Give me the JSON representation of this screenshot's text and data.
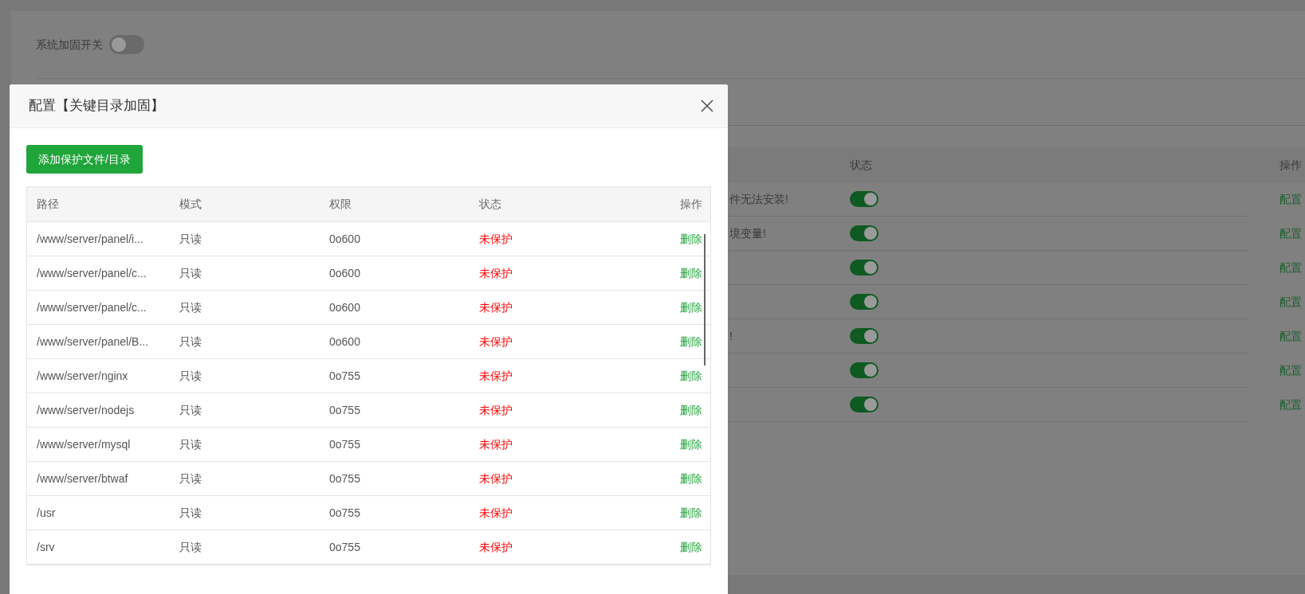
{
  "page": {
    "hardening_switch": {
      "label": "系统加固开关",
      "on": false
    },
    "table": {
      "columns": [
        "状态",
        "操作"
      ],
      "rows": [
        {
          "description": "件无法安装!",
          "on": true,
          "action": "配置"
        },
        {
          "description": "境变量!",
          "on": true,
          "action": "配置"
        },
        {
          "on": true,
          "action": "配置"
        },
        {
          "on": true,
          "action": "配置"
        },
        {
          "description": "!",
          "on": true,
          "action": "配置"
        },
        {
          "on": true,
          "action": "配置"
        },
        {
          "on": true,
          "action": "配置"
        }
      ]
    }
  },
  "dialog": {
    "title": "配置【关键目录加固】",
    "add_button": "添加保护文件/目录",
    "table": {
      "columns": [
        "路径",
        "模式",
        "权限",
        "状态",
        "操作"
      ],
      "rows": [
        {
          "path": "/www/server/panel/i...",
          "mode": "只读",
          "permission": "0o600",
          "status": "未保护",
          "protected": false,
          "action": "删除"
        },
        {
          "path": "/www/server/panel/c...",
          "mode": "只读",
          "permission": "0o600",
          "status": "未保护",
          "protected": false,
          "action": "删除"
        },
        {
          "path": "/www/server/panel/c...",
          "mode": "只读",
          "permission": "0o600",
          "status": "未保护",
          "protected": false,
          "action": "删除"
        },
        {
          "path": "/www/server/panel/B...",
          "mode": "只读",
          "permission": "0o600",
          "status": "未保护",
          "protected": false,
          "action": "删除"
        },
        {
          "path": "/www/server/nginx",
          "mode": "只读",
          "permission": "0o755",
          "status": "未保护",
          "protected": false,
          "action": "删除"
        },
        {
          "path": "/www/server/nodejs",
          "mode": "只读",
          "permission": "0o755",
          "status": "未保护",
          "protected": false,
          "action": "删除"
        },
        {
          "path": "/www/server/mysql",
          "mode": "只读",
          "permission": "0o755",
          "status": "未保护",
          "protected": false,
          "action": "删除"
        },
        {
          "path": "/www/server/btwaf",
          "mode": "只读",
          "permission": "0o755",
          "status": "未保护",
          "protected": false,
          "action": "删除"
        },
        {
          "path": "/usr",
          "mode": "只读",
          "permission": "0o755",
          "status": "未保护",
          "protected": false,
          "action": "删除"
        },
        {
          "path": "/srv",
          "mode": "只读",
          "permission": "0o755",
          "status": "未保护",
          "protected": false,
          "action": "删除"
        }
      ]
    }
  }
}
